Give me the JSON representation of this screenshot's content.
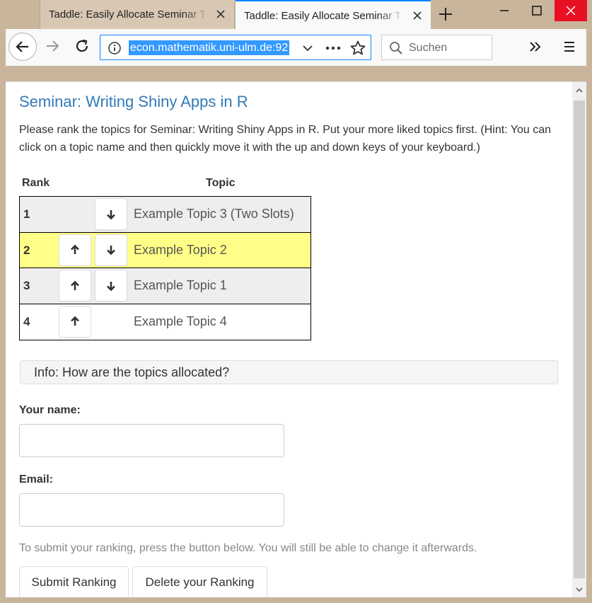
{
  "browser": {
    "tabs": [
      {
        "title": "Taddle: Easily Allocate Seminar Topics",
        "active": false
      },
      {
        "title": "Taddle: Easily Allocate Seminar Topics",
        "active": true
      }
    ],
    "url": "econ.mathematik.uni-ulm.de:92",
    "search_placeholder": "Suchen",
    "accent_color": "#0a84ff"
  },
  "page": {
    "title": "Seminar: Writing Shiny Apps in R",
    "instructions": "Please rank the topics for Seminar: Writing Shiny Apps in R. Put your more liked topics first. (Hint: You can click on a topic name and then quickly move it with the up and down keys of your keyboard.)",
    "rank_header": "Rank",
    "topic_header": "Topic",
    "rows": [
      {
        "rank": "1",
        "topic": "Example Topic 3 (Two Slots)",
        "up": false,
        "down": true,
        "bg": "#eeeeee"
      },
      {
        "rank": "2",
        "topic": "Example Topic 2",
        "up": true,
        "down": true,
        "bg": "#ffff88"
      },
      {
        "rank": "3",
        "topic": "Example Topic 1",
        "up": true,
        "down": true,
        "bg": "#eeeeee"
      },
      {
        "rank": "4",
        "topic": "Example Topic 4",
        "up": true,
        "down": false,
        "bg": "#ffffff"
      }
    ],
    "info_panel": "Info: How are the topics allocated?",
    "name_label": "Your name:",
    "email_label": "Email:",
    "name_value": "",
    "email_value": "",
    "submit_hint": "To submit your ranking, press the button below. You will still be able to change it afterwards.",
    "submit_button": "Submit Ranking",
    "delete_button": "Delete your Ranking",
    "title_color": "#337ab7"
  }
}
